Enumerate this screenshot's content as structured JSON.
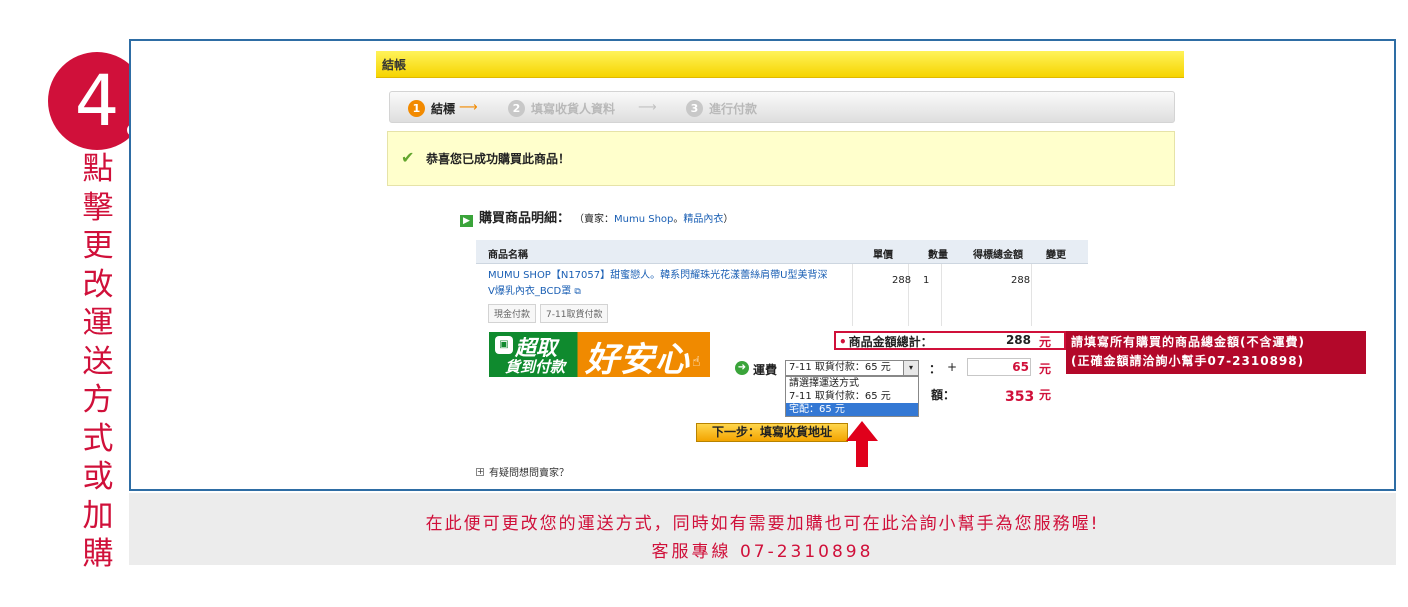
{
  "step": {
    "number": "4",
    "vertical_text": "點擊更改運送方式或加購"
  },
  "colors": {
    "accent_red": "#d0103a",
    "frame_blue": "#2e6da4",
    "orange": "#f28a00",
    "green": "#3aa43a"
  },
  "checkout": {
    "title": "結帳",
    "steps": [
      {
        "num": "1",
        "label": "結標"
      },
      {
        "num": "2",
        "label": "填寫收貨人資料"
      },
      {
        "num": "3",
        "label": "進行付款"
      }
    ],
    "arrow_glyph": "⟶",
    "success_icon": "check-icon",
    "success_message": "恭喜您已成功購買此商品！"
  },
  "detail": {
    "title": "購買商品明細：",
    "seller_prefix": "（賣家：",
    "seller_name": "Mumu Shop",
    "seller_sep": "。",
    "seller_category": "精品內衣",
    "seller_suffix": "）",
    "columns": [
      "商品名稱",
      "單價",
      "數量",
      "得標總金額",
      "變更"
    ],
    "product": {
      "name": "MUMU SHOP【N17057】甜蜜戀人。韓系閃耀珠光花漾蕾絲肩帶U型美背深V爆乳內衣_BCD罩",
      "cart_icon": "cart-icon",
      "unit_price": "288",
      "quantity": "1",
      "total": "288"
    },
    "pay_tags": [
      "現金付款",
      "7-11取貨付款"
    ]
  },
  "promo": {
    "line1": "超取",
    "line2": "貨到付款",
    "big": "好安心",
    "hand_icon": "hand-cursor-icon",
    "bag_icon": "shopping-bag-icon"
  },
  "totals": {
    "bullet": "•",
    "product_total_label": "商品金額總計：",
    "product_total_value": "288",
    "unit": "元",
    "shipping_label": "運費",
    "shipping_selected": "7-11 取貨付款：65 元",
    "select_button_glyph": "▾",
    "colon": "：",
    "plus": "+",
    "shipping_value": "65",
    "shipping_options": [
      "請選擇運送方式",
      "7-11 取貨付款：65 元",
      "宅配：65 元"
    ],
    "grand_label_fragment": "額：",
    "grand_total_value": "353"
  },
  "callout": {
    "line1": "請填寫所有購買的商品總金額(不含運費)",
    "line2": "(正確金額請洽詢小幫手07-2310898)"
  },
  "next_button": "下一步：填寫收貨地址",
  "question_link": "有疑問想問賣家？",
  "caption": {
    "line1": "在此便可更改您的運送方式，同時如有需要加購也可在此洽詢小幫手為您服務喔!",
    "line2": "客服專線  07-2310898"
  }
}
